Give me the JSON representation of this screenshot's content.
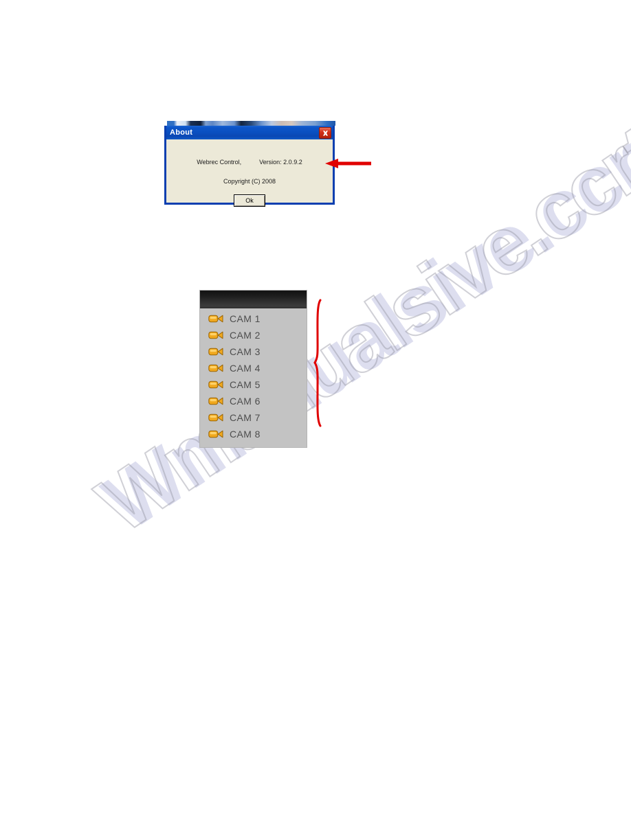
{
  "page": {
    "background_color": "#ffffff",
    "watermark_text": "Wmanualsive.ccrtv",
    "annotation_color": "#e00000"
  },
  "about_dialog": {
    "title": "About",
    "close_icon": "close-icon",
    "product_name": "Webrec Control,",
    "version_label": "Version: 2.0.9.2",
    "copyright": "Copyright (C) 2008",
    "ok_label": "Ok",
    "titlebar_color": "#0a4fc0",
    "body_color": "#ece9d8",
    "border_color": "#0a3fb0"
  },
  "camera_panel": {
    "header_color": "#202020",
    "body_color": "#c3c3c3",
    "icon_color": "#f0a81e",
    "items": [
      {
        "label": "CAM 1",
        "icon": "camcorder-icon"
      },
      {
        "label": "CAM 2",
        "icon": "camcorder-icon"
      },
      {
        "label": "CAM 3",
        "icon": "camcorder-icon"
      },
      {
        "label": "CAM 4",
        "icon": "camcorder-icon"
      },
      {
        "label": "CAM 5",
        "icon": "camcorder-icon"
      },
      {
        "label": "CAM 6",
        "icon": "camcorder-icon"
      },
      {
        "label": "CAM 7",
        "icon": "camcorder-icon"
      },
      {
        "label": "CAM 8",
        "icon": "camcorder-icon"
      }
    ]
  },
  "annotations": {
    "arrow": {
      "name": "callout-arrow-to-about-dialog",
      "direction": "left"
    },
    "brace": {
      "name": "callout-brace-camera-list"
    }
  }
}
